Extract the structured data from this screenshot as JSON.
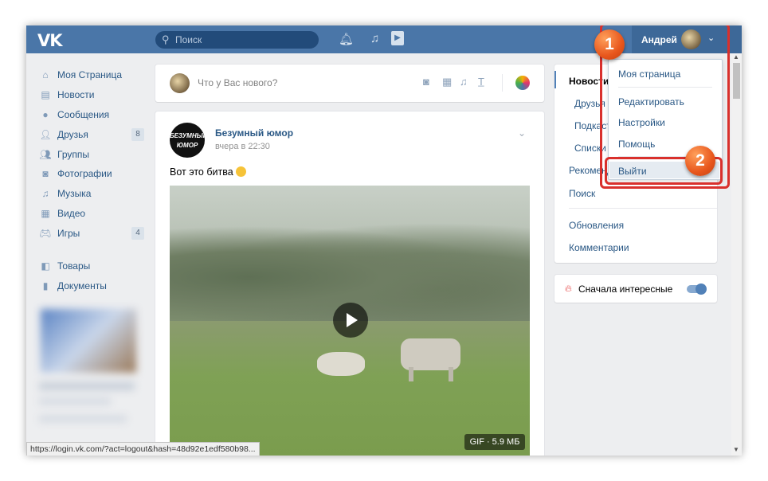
{
  "header": {
    "logo": "VK",
    "search_placeholder": "Поиск",
    "user_name": "Андрей"
  },
  "sidebar": {
    "items": [
      {
        "label": "Моя Страница"
      },
      {
        "label": "Новости"
      },
      {
        "label": "Сообщения"
      },
      {
        "label": "Друзья",
        "count": "8"
      },
      {
        "label": "Группы"
      },
      {
        "label": "Фотографии"
      },
      {
        "label": "Музыка"
      },
      {
        "label": "Видео"
      },
      {
        "label": "Игры",
        "count": "4"
      },
      {
        "label": "Товары"
      },
      {
        "label": "Документы"
      }
    ]
  },
  "compose": {
    "placeholder": "Что у Вас нового?"
  },
  "post": {
    "author": "Безумный юмор",
    "avatar_text": "БЕЗУМНЫЙ ЮМОР",
    "time": "вчера в 22:30",
    "text": "Вот это битва",
    "attachment_label": "GIF · 5.9 МБ"
  },
  "right_nav": {
    "items": [
      "Новости",
      "Друзья",
      "Подкасты",
      "Списки",
      "Рекомендации",
      "Поиск"
    ],
    "extra": [
      "Обновления",
      "Комментарии"
    ],
    "toggle_label": "Сначала интересные",
    "toggle_on": true
  },
  "dropdown": {
    "items": [
      "Моя страница",
      "Редактировать",
      "Настройки",
      "Помощь",
      "Выйти"
    ]
  },
  "callouts": {
    "one": "1",
    "two": "2"
  },
  "status_bar": "https://login.vk.com/?act=logout&hash=48d92e1edf580b98...",
  "colors": {
    "accent": "#4a76a8",
    "link": "#2a5885",
    "callout_border": "#d9302c",
    "callout_badge": "#e8561c"
  }
}
